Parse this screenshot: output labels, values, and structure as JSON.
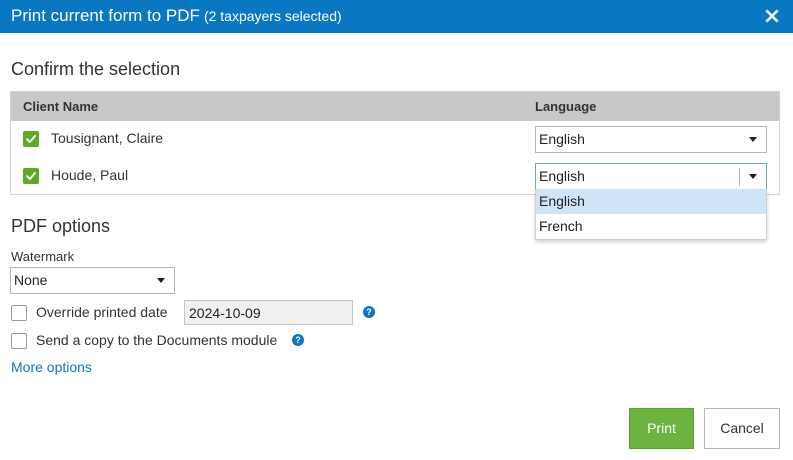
{
  "dialog": {
    "title": "Print current form to PDF",
    "subtitle": "(2 taxpayers selected)"
  },
  "selection": {
    "heading": "Confirm the selection",
    "columns": [
      "Client Name",
      "Language"
    ],
    "rows": [
      {
        "name": "Tousignant, Claire",
        "checked": true,
        "language": "English"
      },
      {
        "name": "Houde, Paul",
        "checked": true,
        "language": "English"
      }
    ],
    "language_options": [
      "English",
      "French"
    ],
    "open_dropdown_selected": "English"
  },
  "pdf_options": {
    "heading": "PDF options",
    "watermark_label": "Watermark",
    "watermark_value": "None",
    "override_date_label": "Override printed date",
    "override_date_checked": false,
    "override_date_value": "2024-10-09",
    "send_copy_label": "Send a copy to the Documents module",
    "send_copy_checked": false,
    "more_options_link": "More options"
  },
  "actions": {
    "print_label": "Print",
    "cancel_label": "Cancel"
  },
  "icons": {
    "close": "close-icon",
    "check": "check-icon",
    "help": "help-icon",
    "caret": "chevron-down-icon"
  },
  "colors": {
    "title_bar": "#0a77c2",
    "primary_button": "#6db33f",
    "checkbox_checked": "#5eaa28",
    "link": "#1074c0",
    "dropdown_highlight": "#cfe4f7"
  }
}
